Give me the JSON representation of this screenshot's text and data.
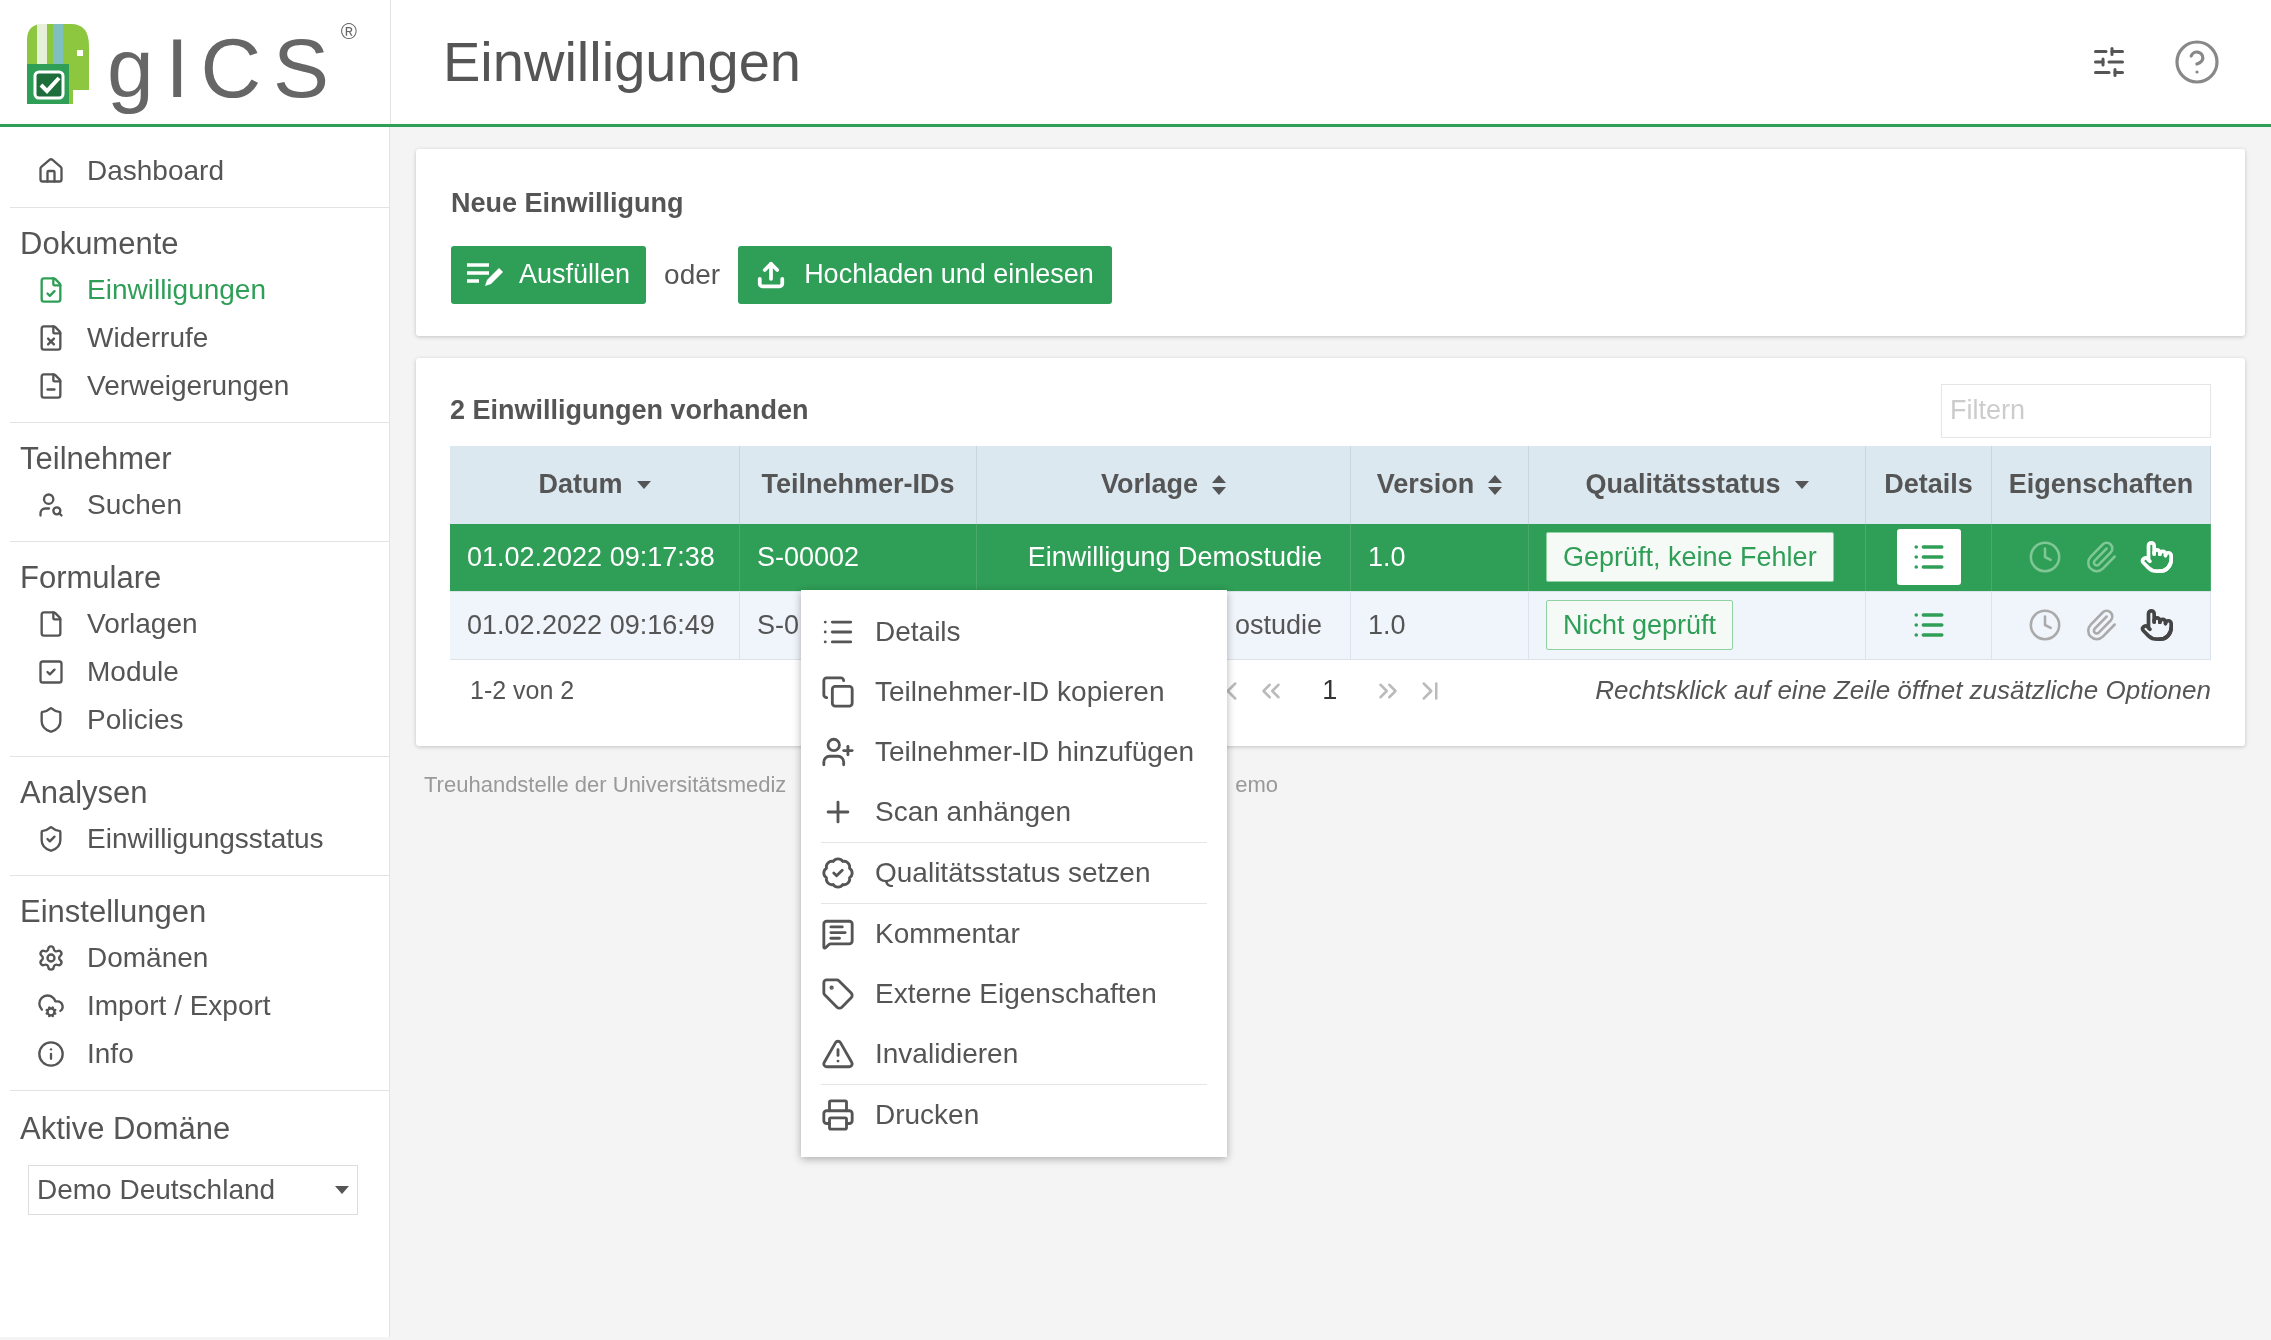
{
  "logo": {
    "text": "gICS",
    "mark": "®"
  },
  "header": {
    "title": "Einwilligungen"
  },
  "sidebar": {
    "top": [
      {
        "label": "Dashboard",
        "selected": false
      }
    ],
    "sections": [
      {
        "heading": "Dokumente",
        "items": [
          {
            "label": "Einwilligungen",
            "selected": true
          },
          {
            "label": "Widerrufe",
            "selected": false
          },
          {
            "label": "Verweigerungen",
            "selected": false
          }
        ]
      },
      {
        "heading": "Teilnehmer",
        "items": [
          {
            "label": "Suchen",
            "selected": false
          }
        ]
      },
      {
        "heading": "Formulare",
        "items": [
          {
            "label": "Vorlagen",
            "selected": false
          },
          {
            "label": "Module",
            "selected": false
          },
          {
            "label": "Policies",
            "selected": false
          }
        ]
      },
      {
        "heading": "Analysen",
        "items": [
          {
            "label": "Einwilligungsstatus",
            "selected": false
          }
        ]
      },
      {
        "heading": "Einstellungen",
        "items": [
          {
            "label": "Domänen",
            "selected": false
          },
          {
            "label": "Import / Export",
            "selected": false
          },
          {
            "label": "Info",
            "selected": false
          }
        ]
      }
    ],
    "domain": {
      "heading": "Aktive Domäne",
      "value": "Demo Deutschland"
    }
  },
  "new_consent": {
    "title": "Neue Einwilligung",
    "buttons": [
      {
        "label": "Ausfüllen"
      },
      {
        "label": "Hochladen und einlesen"
      }
    ],
    "separator": "oder"
  },
  "table_card": {
    "title": "2 Einwilligungen vorhanden",
    "filter": {
      "placeholder": "Filtern"
    },
    "columns": [
      {
        "label": "Datum",
        "kind": "sort_desc"
      },
      {
        "label": "Teilnehmer-IDs",
        "kind": "plain"
      },
      {
        "label": "Vorlage",
        "kind": "sortable"
      },
      {
        "label": "Version",
        "kind": "sortable"
      },
      {
        "label": "Qualitätsstatus",
        "kind": "dropdown"
      },
      {
        "label": "Details",
        "kind": "plain"
      },
      {
        "label": "Eigenschaften",
        "kind": "plain"
      }
    ],
    "rows": [
      {
        "selected": true,
        "date": "01.02.2022 09:17:38",
        "participant": "S-00002",
        "template": "Einwilligung Demostudie",
        "version": "1.0",
        "quality": "Geprüft, keine Fehler",
        "properties": [
          {
            "active": false
          },
          {
            "active": false
          },
          {
            "active": true
          }
        ]
      },
      {
        "selected": false,
        "date": "01.02.2022 09:16:49",
        "participant": "S-0",
        "template": "ostudie",
        "version": "1.0",
        "quality": "Nicht geprüft",
        "properties": [
          {
            "active": false
          },
          {
            "active": false
          },
          {
            "active": true
          }
        ]
      }
    ],
    "pagination": {
      "range": "1-2 von 2",
      "page": "1",
      "hint": "Rechtsklick auf eine Zeile öffnet zusätzliche Optionen"
    }
  },
  "footer": [
    "Treuhandstelle der Universitätsmediz",
    "emo"
  ],
  "context_menu": {
    "items": [
      {
        "label": "Details",
        "divider_after": false
      },
      {
        "label": "Teilnehmer-ID kopieren",
        "divider_after": false
      },
      {
        "label": "Teilnehmer-ID hinzufügen",
        "divider_after": false
      },
      {
        "label": "Scan anhängen",
        "divider_after": true
      },
      {
        "label": "Qualitätsstatus setzen",
        "divider_after": true
      },
      {
        "label": "Kommentar",
        "divider_after": false
      },
      {
        "label": "Externe Eigenschaften",
        "divider_after": false
      },
      {
        "label": "Invalidieren",
        "divider_after": true
      },
      {
        "label": "Drucken",
        "divider_after": false
      }
    ]
  }
}
